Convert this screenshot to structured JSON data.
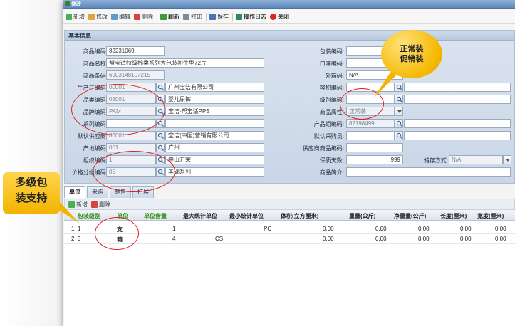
{
  "window": {
    "title": "修改"
  },
  "toolbar": {
    "new": "新增",
    "edit": "修改",
    "editor": "编辑",
    "delete": "删除",
    "refresh": "刷新",
    "print": "打印",
    "save": "保存",
    "log": "操作日志",
    "close": "关闭"
  },
  "section": {
    "title": "基本信息"
  },
  "form": {
    "product_code": {
      "label": "商品编码:",
      "value": "82231069."
    },
    "product_name": {
      "label": "商品名称:",
      "value": "帮宝适特级棉柔系列大包装初生型72片"
    },
    "barcode": {
      "label": "商品条码:",
      "value": "6903148107215"
    },
    "manufacturer": {
      "label": "生产厂编码:",
      "code": "00001",
      "name": "广州宝洁有限公司"
    },
    "category": {
      "label": "品类编码:",
      "code": "05001",
      "name": "婴儿尿裤"
    },
    "brand": {
      "label": "品牌编码:",
      "code": "PAM",
      "name": "宝洁-帮宝适PPS"
    },
    "series": {
      "label": "系列编码:",
      "code": "",
      "name": ""
    },
    "supplier": {
      "label": "默认供应商:",
      "code": "80001",
      "name": "宝洁(中国)营销有限公司"
    },
    "origin": {
      "label": "产地编码:",
      "code": "001",
      "name": "广州"
    },
    "org": {
      "label": "组织编码:",
      "code": "1",
      "name": "中山万荣"
    },
    "price_group": {
      "label": "价格分组编码:",
      "code": "05",
      "name": "基础系列"
    },
    "package_code": {
      "label": "包装编码:",
      "value": ""
    },
    "taste_code": {
      "label": "口味编码:",
      "value": ""
    },
    "ext_code": {
      "label": "外箱码:",
      "value": "N/A"
    },
    "volume_code": {
      "label": "容积编码:",
      "value": ""
    },
    "level_code": {
      "label": "级别编码:",
      "value": ""
    },
    "attribute": {
      "label": "商品属性:",
      "value": "正常装"
    },
    "product_group": {
      "label": "产品组编码:",
      "value": "82198499."
    },
    "buyer": {
      "label": "默认采购员:",
      "value": ""
    },
    "supplier_item": {
      "label": "供应商商品编码:",
      "value": ""
    },
    "shelf_days": {
      "label": "保质天数:",
      "value": "999"
    },
    "storage": {
      "label": "储存方式:",
      "value": "N/A"
    },
    "intro": {
      "label": "商品简介:",
      "value": ""
    }
  },
  "tabs": [
    "单位",
    "采购",
    "销售",
    "扩展"
  ],
  "grid_toolbar": {
    "new": "新增",
    "delete": "删除"
  },
  "grid": {
    "headers": [
      "包装级别",
      "单位",
      "单位含量",
      "最大统计单位",
      "最小统计单位",
      "体积(立方厘米)",
      "重量(公斤)",
      "净重量(公斤)",
      "长度(厘米)",
      "宽度(厘米)"
    ],
    "rows": [
      {
        "idx": "1",
        "level": "1",
        "unit": "支",
        "qty": "1",
        "max_unit": "",
        "min_unit": "PC",
        "volume": "0.00",
        "weight": "0.00",
        "net": "0.00",
        "length": "0.00",
        "width": "0.00"
      },
      {
        "idx": "2",
        "level": "3",
        "unit": "箱",
        "qty": "4",
        "max_unit": "CS",
        "min_unit": "",
        "volume": "0.00",
        "weight": "0.00",
        "net": "0.00",
        "length": "0.00",
        "width": "0.00"
      }
    ]
  },
  "callouts": {
    "left": "多级包\n装支持",
    "right": "正常装\n促销装"
  },
  "colors": {
    "highlight": "#e02020",
    "bubble": "#f5b800",
    "title_bar": "#5f88bb",
    "header_green": "#2c8c1c"
  }
}
